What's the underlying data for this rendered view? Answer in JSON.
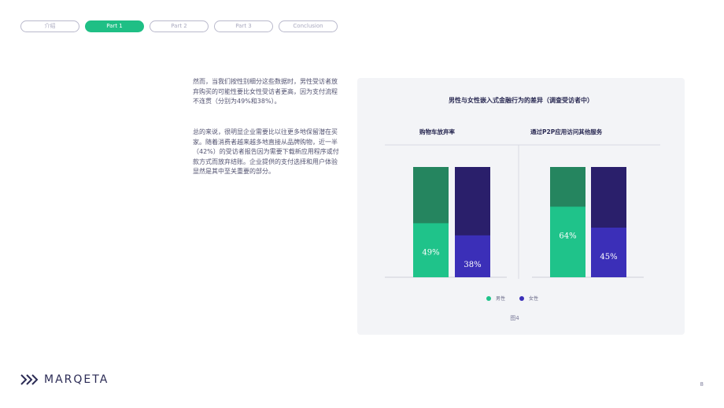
{
  "nav": {
    "tabs": [
      {
        "label": "介绍",
        "active": false
      },
      {
        "label": "Part 1",
        "active": true
      },
      {
        "label": "Part 2",
        "active": false
      },
      {
        "label": "Part 3",
        "active": false
      },
      {
        "label": "Conclusion",
        "active": false
      }
    ]
  },
  "body": {
    "paragraph1": "然而，当我们按性别细分这些数据时，男性受访者放弃购买的可能性要比女性受访者更高，因为支付流程不连贯（分别为49%和38%）。",
    "paragraph2": "总的来说，很明显企业需要比以往更多地保留潜在买家。随着消费者越来越多地直接从品牌购物，近一半（42%）的受访者报告因为需要下载新应用程序或付款方式而放弃结账。企业提供的支付选择和用户体验显然是其中至关重要的部分。"
  },
  "chart_data": {
    "type": "bar",
    "stacked": true,
    "title": "男性与女性嵌入式金融行为的差异（调查受访者中）",
    "groups": [
      {
        "label": "购物车放弃率",
        "series": [
          {
            "name": "男性",
            "value": 49,
            "label": "49%"
          },
          {
            "name": "女性",
            "value": 38,
            "label": "38%"
          }
        ]
      },
      {
        "label": "通过P2P应用访问其他服务",
        "series": [
          {
            "name": "男性",
            "value": 64,
            "label": "64%"
          },
          {
            "name": "女性",
            "value": 45,
            "label": "45%"
          }
        ]
      }
    ],
    "ylim": [
      0,
      100
    ],
    "legend": [
      {
        "name": "男性",
        "color": "#1fc38a"
      },
      {
        "name": "女性",
        "color": "#3b2fb8"
      }
    ],
    "legend_position": "bottom",
    "colors": {
      "male": "#1fc38a",
      "male_bg": "#25855f",
      "female": "#3b2fb8",
      "female_bg": "#2a1f6b"
    },
    "caption": "图4"
  },
  "footer": {
    "logo_text": "MARQETA",
    "page_number": "8"
  }
}
